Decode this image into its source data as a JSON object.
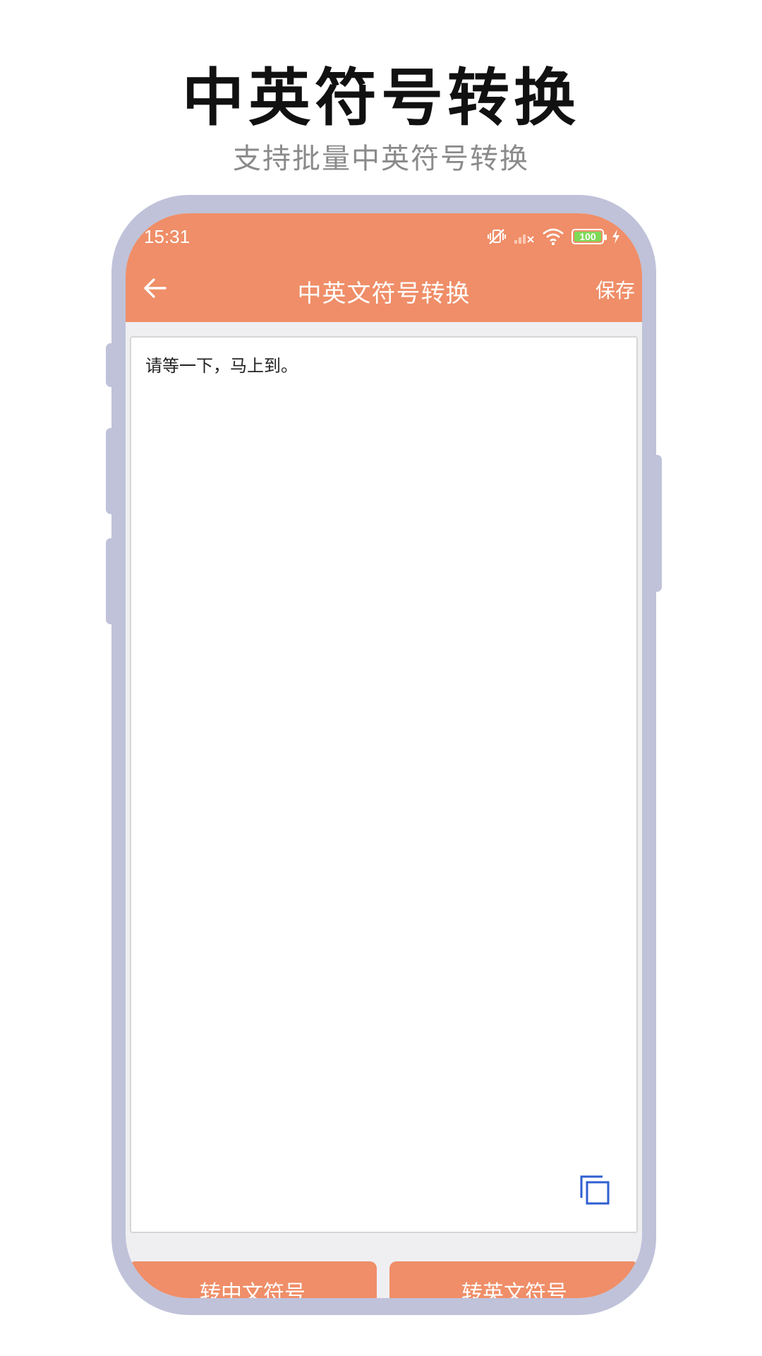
{
  "promo": {
    "title": "中英符号转换",
    "subtitle": "支持批量中英符号转换"
  },
  "status_bar": {
    "time": "15:31",
    "battery": "100",
    "icons": [
      "mute-vibrate-icon",
      "signal-icon",
      "wifi-icon",
      "battery-icon",
      "charging-icon"
    ]
  },
  "nav": {
    "back_icon": "arrow-left-icon",
    "title": "中英文符号转换",
    "save_label": "保存"
  },
  "editor": {
    "text": "请等一下，马上到。",
    "copy_icon": "copy-icon"
  },
  "actions": {
    "to_chinese": "转中文符号",
    "to_english": "转英文符号"
  },
  "colors": {
    "accent": "#ef8e68",
    "frame": "#bfc2d9",
    "copy_icon": "#2f5fd0"
  }
}
